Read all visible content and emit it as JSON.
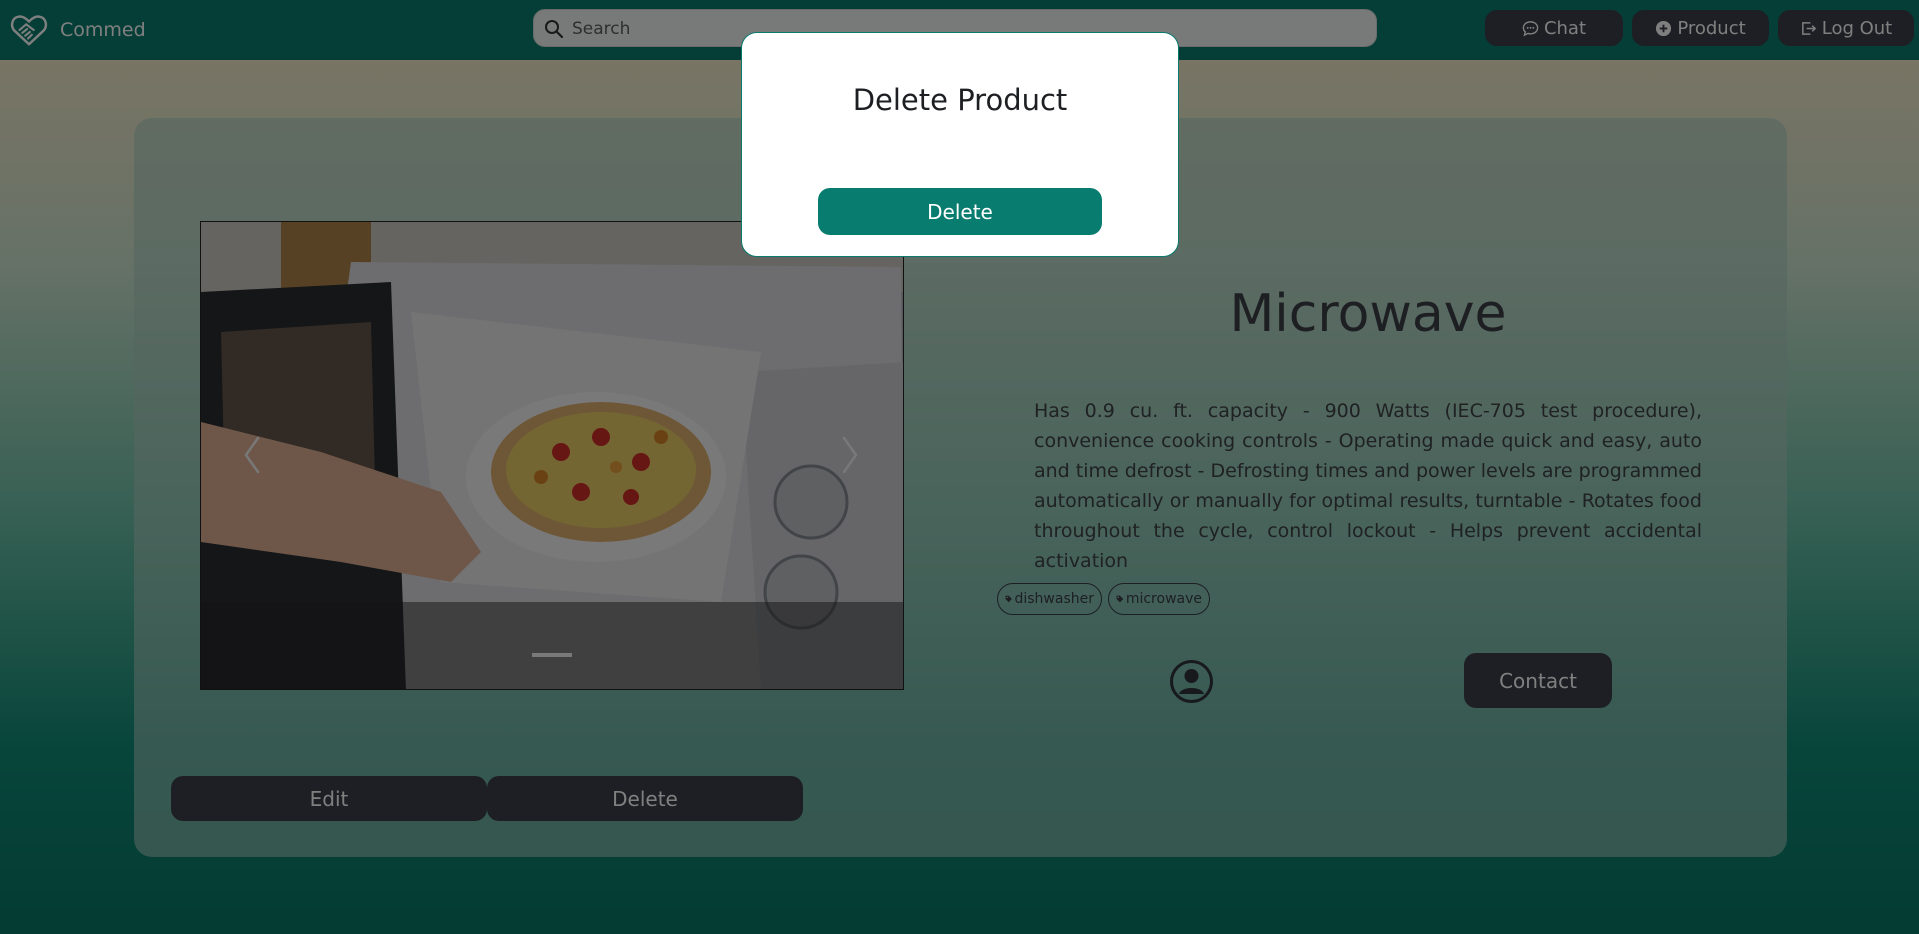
{
  "header": {
    "brand_name": "Commed",
    "search_placeholder": "Search",
    "nav": {
      "chat_label": "Chat",
      "product_label": "Product",
      "logout_label": "Log Out"
    }
  },
  "product": {
    "title": "Microwave",
    "description": "Has 0.9 cu. ft. capacity - 900 Watts (IEC-705 test procedure), convenience cooking controls - Operating made quick and easy, auto and time defrost - Defrosting times and power levels are programmed automatically or manually for optimal results, turntable - Rotates food throughout the cycle, control lockout - Helps prevent accidental activation",
    "tags": [
      "dishwasher",
      "microwave"
    ],
    "contact_label": "Contact"
  },
  "actions": {
    "edit_label": "Edit",
    "delete_label": "Delete"
  },
  "modal": {
    "title": "Delete Product",
    "confirm_label": "Delete"
  },
  "colors": {
    "header_bg": "#087c6e",
    "dark_button": "#3b3e4a",
    "primary": "#087c6e"
  },
  "icons": [
    "handshake-heart-logo-icon",
    "search-icon",
    "chat-icon",
    "plus-circle-icon",
    "logout-icon",
    "chevron-left-icon",
    "chevron-right-icon",
    "tag-icon",
    "user-avatar-icon"
  ]
}
